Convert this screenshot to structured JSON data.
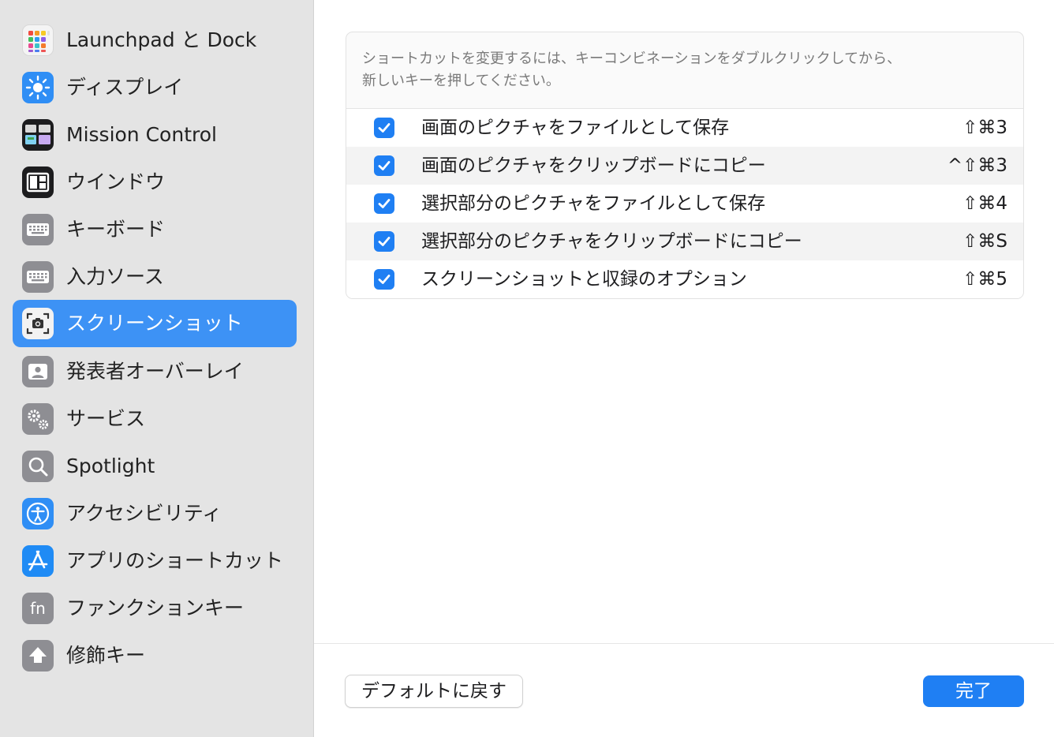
{
  "sidebar": {
    "items": [
      {
        "label": "Launchpad と Dock",
        "icon": "launchpad-icon"
      },
      {
        "label": "ディスプレイ",
        "icon": "display-brightness-icon"
      },
      {
        "label": "Mission Control",
        "icon": "mission-control-icon"
      },
      {
        "label": "ウインドウ",
        "icon": "window-icon"
      },
      {
        "label": "キーボード",
        "icon": "keyboard-icon"
      },
      {
        "label": "入力ソース",
        "icon": "input-source-keyboard-icon"
      },
      {
        "label": "スクリーンショット",
        "icon": "screenshot-icon",
        "selected": true
      },
      {
        "label": "発表者オーバーレイ",
        "icon": "presenter-overlay-icon"
      },
      {
        "label": "サービス",
        "icon": "gears-icon"
      },
      {
        "label": "Spotlight",
        "icon": "magnifier-icon"
      },
      {
        "label": "アクセシビリティ",
        "icon": "accessibility-icon"
      },
      {
        "label": "アプリのショートカット",
        "icon": "app-store-icon"
      },
      {
        "label": "ファンクションキー",
        "icon": "fn-key-icon"
      },
      {
        "label": "修飾キー",
        "icon": "modifier-arrow-icon"
      }
    ]
  },
  "panel": {
    "instruction_line1": "ショートカットを変更するには、キーコンビネーションをダブルクリックしてから、",
    "instruction_line2": "新しいキーを押してください。",
    "shortcuts": [
      {
        "label": "画面のピクチャをファイルとして保存",
        "keys": "⇧⌘3",
        "checked": true
      },
      {
        "label": "画面のピクチャをクリップボードにコピー",
        "keys": "^⇧⌘3",
        "checked": true
      },
      {
        "label": "選択部分のピクチャをファイルとして保存",
        "keys": "⇧⌘4",
        "checked": true
      },
      {
        "label": "選択部分のピクチャをクリップボードにコピー",
        "keys": "⇧⌘S",
        "checked": true
      },
      {
        "label": "スクリーンショットと収録のオプション",
        "keys": "⇧⌘5",
        "checked": true
      }
    ]
  },
  "footer": {
    "restore_defaults_label": "デフォルトに戻す",
    "done_label": "完了"
  },
  "colors": {
    "accent": "#1f7ff3",
    "sidebar_selected": "#3d92f5",
    "sidebar_bg": "#e4e4e4"
  }
}
